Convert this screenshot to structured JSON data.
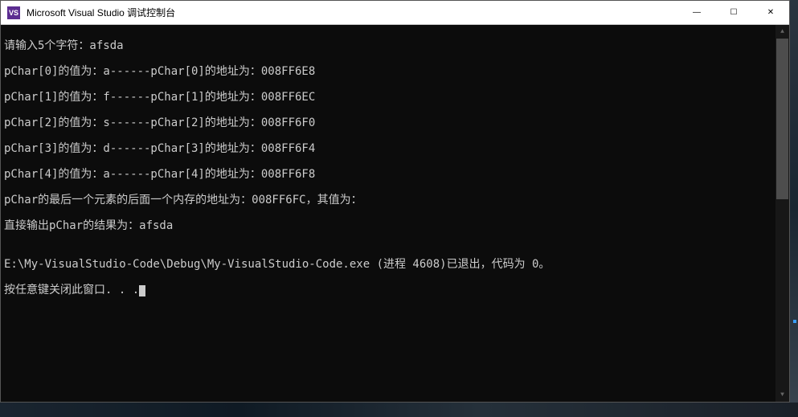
{
  "titlebar": {
    "icon_text": "VS",
    "title": "Microsoft Visual Studio 调试控制台"
  },
  "win_controls": {
    "minimize": "—",
    "maximize": "☐",
    "close": "✕"
  },
  "console": {
    "lines": [
      "请输入5个字符：afsda",
      "pChar[0]的值为：a------pChar[0]的地址为：008FF6E8",
      "pChar[1]的值为：f------pChar[1]的地址为：008FF6EC",
      "pChar[2]的值为：s------pChar[2]的地址为：008FF6F0",
      "pChar[3]的值为：d------pChar[3]的地址为：008FF6F4",
      "pChar[4]的值为：a------pChar[4]的地址为：008FF6F8",
      "pChar的最后一个元素的后面一个内存的地址为：008FF6FC，其值为：",
      "直接输出pChar的结果为：afsda",
      "",
      "E:\\My-VisualStudio-Code\\Debug\\My-VisualStudio-Code.exe (进程 4608)已退出，代码为 0。",
      "按任意键关闭此窗口. . ."
    ]
  },
  "scrollbar": {
    "up": "▲",
    "down": "▼"
  }
}
